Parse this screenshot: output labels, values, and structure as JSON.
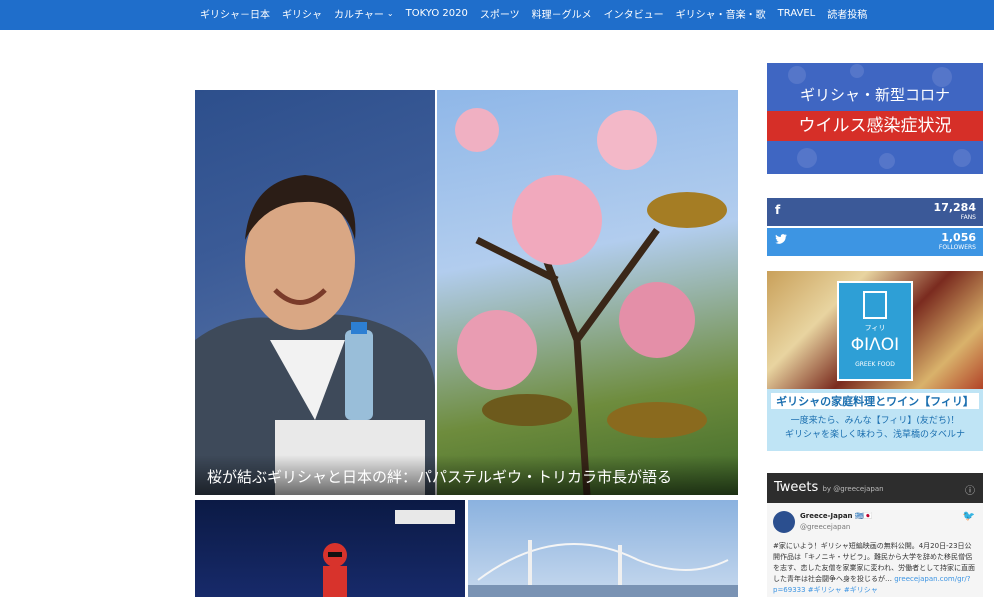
{
  "nav": {
    "items": [
      {
        "label": "ギリシャ－日本"
      },
      {
        "label": "ギリシャ"
      },
      {
        "label": "カルチャー"
      },
      {
        "label": "TOKYO 2020"
      },
      {
        "label": "スポーツ"
      },
      {
        "label": "料理－グルメ"
      },
      {
        "label": "インタビュー"
      },
      {
        "label": "ギリシャ・音楽・歌"
      },
      {
        "label": "TRAVEL"
      },
      {
        "label": "読者投稿"
      }
    ]
  },
  "featured": {
    "title": "桜が結ぶギリシャと日本の絆：パパステルギウ・トリカラ市長が語る"
  },
  "sidebar": {
    "covid_banner": {
      "line1": "ギリシャ・新型コロナ",
      "line2": "ウイルス感染症状況"
    },
    "social": {
      "facebook": {
        "count": "17,284",
        "unit": "FANS",
        "icon": "facebook-icon"
      },
      "twitter": {
        "count": "1,056",
        "unit": "FOLLOWERS",
        "icon": "twitter-icon"
      }
    },
    "filoi_ad": {
      "logo_small": "フィリ",
      "logo_big": "ΦΙΛΟΙ",
      "logo_sub": "GREEK FOOD",
      "line1": "ギリシャの家庭料理とワイン【フィリ】",
      "line2": "一度来たら、みんな【フィリ】(友だち)！",
      "line3": "ギリシャを楽しく味わう、浅草橋のタベルナ"
    },
    "tweets": {
      "header": "Tweets",
      "by": "by @greecejapan",
      "user_name": "Greece-Japan 🇬🇷🇯🇵",
      "handle": "@greecejapan",
      "text": "#家にいよう！ギリシャ短編映画の無料公開。4月20日-23日公開作品は「キノニキ・サビラ」。難民から大学を辞めた移民僧侶を志す、恋した友僧を家業家に変われ、労働者として持家に直面した青年は社会闘争へ身を投じるが…",
      "link": "greecejapan.com/gr/?p=69333 #ギリシャ #ギリシャ"
    }
  }
}
